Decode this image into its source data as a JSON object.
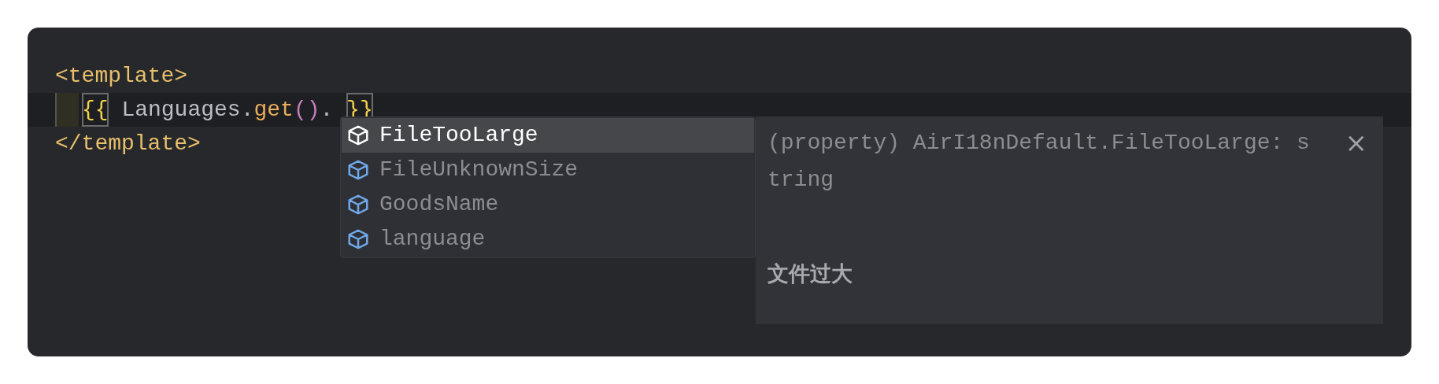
{
  "editor": {
    "lines": [
      {
        "current": false,
        "tokens": [
          {
            "text": "<template>",
            "kind": "tag"
          }
        ]
      },
      {
        "current": true,
        "tokens": [
          {
            "text": "{{",
            "kind": "brace"
          },
          {
            "text": " Languages.",
            "kind": "plain"
          },
          {
            "text": "get",
            "kind": "method"
          },
          {
            "text": "()",
            "kind": "paren"
          },
          {
            "text": ". ",
            "kind": "plain"
          },
          {
            "text": "}}",
            "kind": "brace"
          }
        ]
      },
      {
        "current": false,
        "tokens": [
          {
            "text": "</template>",
            "kind": "tag"
          }
        ]
      }
    ]
  },
  "completion": {
    "items": [
      {
        "label": "FileTooLarge",
        "selected": true
      },
      {
        "label": "FileUnknownSize",
        "selected": false
      },
      {
        "label": "GoodsName",
        "selected": false
      },
      {
        "label": "language",
        "selected": false
      }
    ]
  },
  "details": {
    "signature": "(property) AirI18nDefault.FileTooLarge: s",
    "signature_wrap": "tring",
    "close": "×",
    "doc": "文件过大"
  }
}
